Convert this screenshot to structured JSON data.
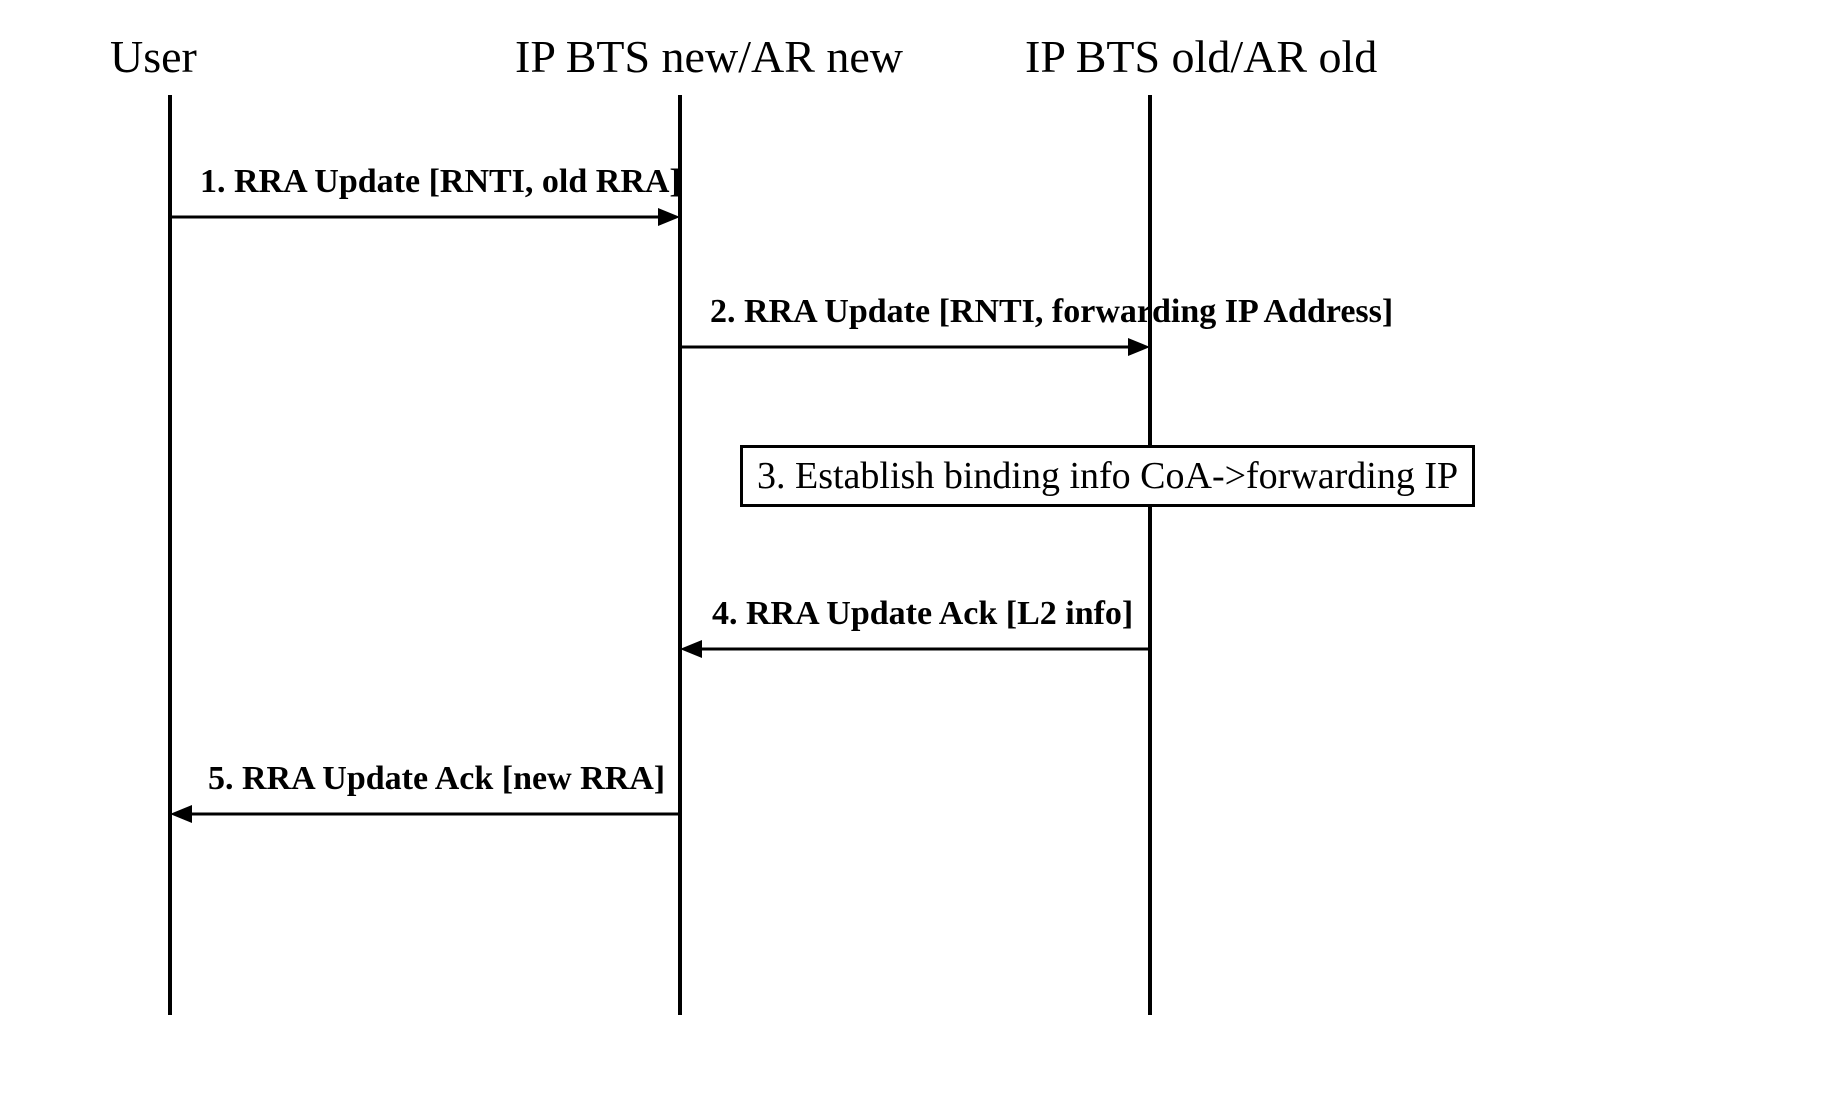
{
  "participants": {
    "user": {
      "label": "User"
    },
    "new": {
      "label": "IP BTS new/AR new"
    },
    "old": {
      "label": "IP BTS old/AR old"
    }
  },
  "messages": {
    "m1": {
      "label": "1. RRA Update [RNTI, old RRA]"
    },
    "m2": {
      "label": "2. RRA Update [RNTI, forwarding IP Address]"
    },
    "m3": {
      "label": "3. Establish binding info CoA->forwarding IP"
    },
    "m4": {
      "label": "4. RRA Update Ack [L2 info]"
    },
    "m5": {
      "label": "5. RRA Update Ack [new RRA]"
    }
  }
}
